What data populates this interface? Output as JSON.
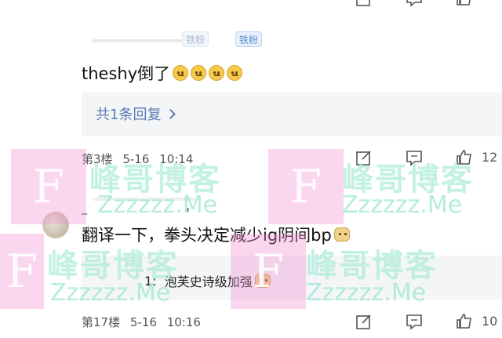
{
  "floor_prev": {
    "actions": [
      {
        "icon": "edit-icon"
      },
      {
        "icon": "comment-icon"
      },
      {
        "icon": "like-icon"
      }
    ]
  },
  "post_a": {
    "badges": [
      "铁粉",
      "铁粉"
    ],
    "text": "theshy倒了",
    "emoji": [
      "sad-face-emoji",
      "sad-face-emoji",
      "sad-face-emoji",
      "sad-face-emoji"
    ],
    "reply_count_label": "共1条回复"
  },
  "floor3": {
    "floor_label": "第3楼",
    "date": "5-16",
    "time": "10:14",
    "like_count": "12"
  },
  "post_b": {
    "username": "_",
    "username_suffix": "，",
    "text": "翻译一下，拳头决定减少ig阴间bp",
    "emoji": "doge-emoji",
    "subreply_prefix": "1:",
    "subreply_text": "泡芙史诗级加强"
  },
  "floor17": {
    "floor_label": "第17楼",
    "date": "5-16",
    "time": "10:16",
    "like_count": "10"
  },
  "watermark": {
    "glyph": "F",
    "title": "峰哥博客",
    "subtitle": "Zzzzzz.Me"
  },
  "colors": {
    "reply_link": "#5a7bb5",
    "badge": "#5a8bd6",
    "reply_box_bg": "#f4f5f7",
    "watermark_pink": "#f08cd2",
    "watermark_green": "#aaebd7"
  }
}
